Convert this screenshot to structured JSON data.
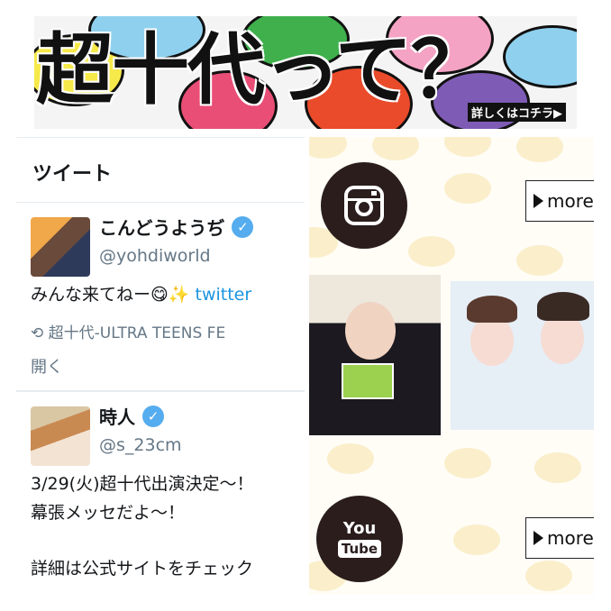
{
  "banner": {
    "title": "超十代って？",
    "details": "詳しくはコチラ▶"
  },
  "twitter": {
    "heading": "ツイート",
    "tweets": [
      {
        "name": "こんどうようぢ",
        "handle": "@yohdiworld",
        "text": "みんな来てねー😋✨",
        "link": "twitter",
        "retweet": "超十代-ULTRA TEENS FE",
        "open": "開く"
      },
      {
        "name": "時人",
        "handle": "@s_23cm",
        "line1": "3/29(火)超十代出演決定〜！",
        "line2": "幕張メッセだよ〜！",
        "line3": "詳細は公式サイトをチェック"
      }
    ]
  },
  "social": {
    "more_label": "more",
    "youtube_top": "You",
    "youtube_bottom": "Tube"
  },
  "colors": {
    "link": "#1b95e0",
    "verified": "#55acee",
    "icon_bg": "#2a1d1c",
    "polka": "#fbeecb"
  }
}
